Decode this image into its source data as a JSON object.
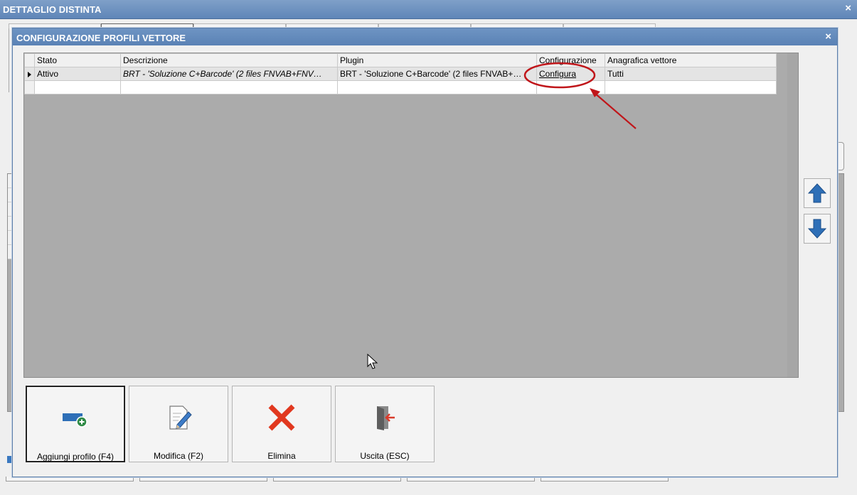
{
  "outer_window": {
    "title": "DETTAGLIO DISTINTA",
    "close": "×"
  },
  "dialog": {
    "title": "CONFIGURAZIONE PROFILI VETTORE",
    "close": "×",
    "grid": {
      "columns": [
        "Stato",
        "Descrizione",
        "Plugin",
        "Configurazione",
        "Anagrafica vettore"
      ],
      "rows": [
        {
          "stato": "Attivo",
          "descrizione": "BRT - 'Soluzione C+Barcode' (2 files FNVAB+FNV…",
          "plugin": "BRT - 'Soluzione C+Barcode' (2 files FNVAB+…",
          "configurazione": "Configura",
          "anagrafica": "Tutti"
        }
      ]
    },
    "side_buttons": {
      "up": "arrow-up-icon",
      "down": "arrow-down-icon"
    },
    "buttons": {
      "add": "Aggiungi profilo (F4)",
      "edit": "Modifica (F2)",
      "delete": "Elimina",
      "exit": "Uscita (ESC)"
    },
    "colors": {
      "title_bar": "#5a82b5",
      "annotation": "#c0161a",
      "arrow_icon": "#2e6fb7"
    }
  }
}
